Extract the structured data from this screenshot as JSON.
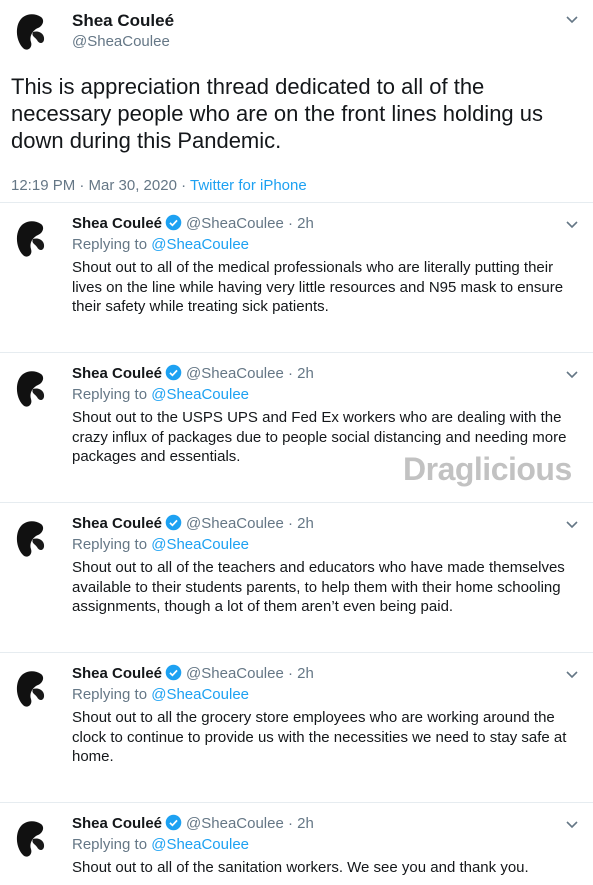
{
  "main": {
    "name": "Shea Couleé",
    "handle": "@SheaCoulee",
    "text": "This is appreciation thread dedicated to all of the necessary people who are on the front lines holding us down during this Pandemic.",
    "timestamp": "12:19 PM · Mar 30, 2020 · ",
    "source": "Twitter for iPhone"
  },
  "replies": [
    {
      "name": "Shea Couleé",
      "handle_time": "@SheaCoulee · 2h",
      "replying_label": "Replying to ",
      "replying_mention": "@SheaCoulee",
      "text": "Shout out to all of the medical professionals who are literally putting their lives on the line while having very little resources and N95 mask to ensure their safety while treating sick patients."
    },
    {
      "name": "Shea Couleé",
      "handle_time": "@SheaCoulee · 2h",
      "replying_label": "Replying to ",
      "replying_mention": "@SheaCoulee",
      "text": "Shout out to the USPS UPS and Fed Ex workers who are dealing with the crazy influx of packages due to people social distancing and needing more packages and essentials."
    },
    {
      "name": "Shea Couleé",
      "handle_time": "@SheaCoulee · 2h",
      "replying_label": "Replying to ",
      "replying_mention": "@SheaCoulee",
      "text": "Shout out to all of the teachers and educators who have made themselves available to their students parents, to help them with their home schooling assignments, though a lot of them aren’t even being paid."
    },
    {
      "name": "Shea Couleé",
      "handle_time": "@SheaCoulee · 2h",
      "replying_label": "Replying to ",
      "replying_mention": "@SheaCoulee",
      "text": "Shout out to all the grocery store employees who are working around the clock to continue to provide us with the necessities we need to stay safe at home."
    },
    {
      "name": "Shea Couleé",
      "handle_time": "@SheaCoulee · 2h",
      "replying_label": "Replying to ",
      "replying_mention": "@SheaCoulee",
      "text": "Shout out to all of the sanitation workers. We see you and thank you."
    }
  ],
  "watermark": "Draglicious",
  "colors": {
    "accent": "#1da1f2",
    "secondary_text": "#657786",
    "divider": "#e6ecf0"
  },
  "icons": {
    "verified": "verified-badge-icon",
    "more": "chevron-down-icon"
  }
}
